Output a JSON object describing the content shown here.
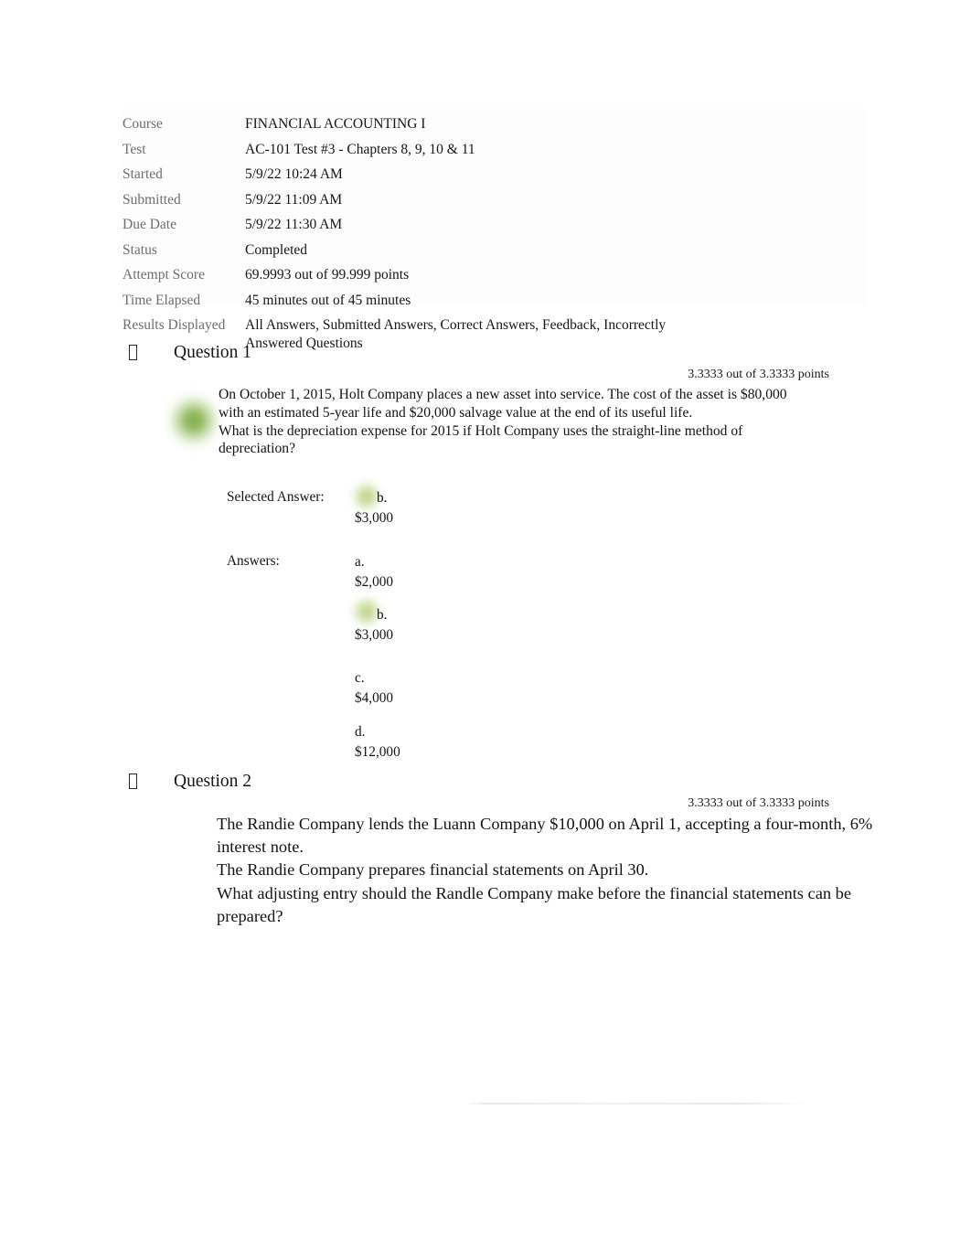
{
  "summary": {
    "rows": [
      {
        "label": "Course",
        "value": "FINANCIAL ACCOUNTING I"
      },
      {
        "label": "Test",
        "value": "AC-101 Test #3 - Chapters 8, 9, 10 & 11"
      },
      {
        "label": "Started",
        "value": "5/9/22 10:24 AM"
      },
      {
        "label": "Submitted",
        "value": "5/9/22 11:09 AM"
      },
      {
        "label": "Due Date",
        "value": "5/9/22 11:30 AM"
      },
      {
        "label": "Status",
        "value": "Completed"
      },
      {
        "label": "Attempt Score",
        "value": "69.9993 out of 99.999 points"
      },
      {
        "label": "Time Elapsed",
        "value": "45 minutes out of 45 minutes"
      },
      {
        "label": "Results Displayed",
        "value": "All Answers, Submitted Answers, Correct Answers, Feedback, Incorrectly Answered Questions"
      }
    ]
  },
  "questions": [
    {
      "marker": "missing-glyph-box",
      "title": "Question 1",
      "points": "3.3333 out of 3.3333 points",
      "body": "On October 1, 2015, Holt Company places a new asset into service. The cost of the asset is $80,000 with an estimated 5-year life and $20,000 salvage value at the end of its useful life.\nWhat is the depreciation expense for 2015 if Holt Company uses the straight-line method of depreciation?",
      "selected_answer_label": "Selected Answer:",
      "answers_label": "Answers:",
      "selected_answer": {
        "letter": "b.",
        "text": "$3,000",
        "correct": true
      },
      "options": [
        {
          "letter": "a.",
          "text": "$2,000",
          "correct": false
        },
        {
          "letter": "b.",
          "text": "$3,000",
          "correct": true
        },
        {
          "letter": "c.",
          "text": "$4,000",
          "correct": false
        },
        {
          "letter": "d.",
          "text": "$12,000",
          "correct": false
        }
      ]
    },
    {
      "marker": "missing-glyph-box",
      "title": "Question 2",
      "points": "3.3333 out of 3.3333 points",
      "body": "The Randie Company lends the Luann Company $10,000 on April 1, accepting a four-month, 6% interest note.\nThe Randie Company prepares financial statements on April 30.\nWhat adjusting entry should the Randle Company make before the financial statements can be prepared?"
    }
  ],
  "colors": {
    "correct_indicator": "#6ca030",
    "correct_indicator_light": "#a8c460",
    "label_gray": "#6e6e6e",
    "body_text": "#141414",
    "panel_bg": "#fdfdfd"
  }
}
